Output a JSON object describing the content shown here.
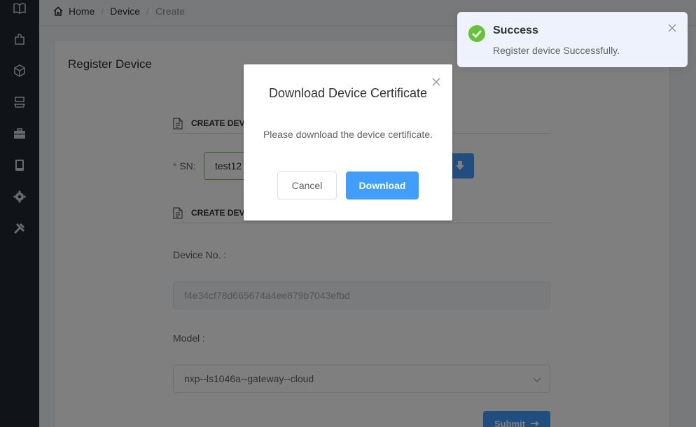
{
  "sidebar": {
    "items": [
      {
        "icon": "book-icon"
      },
      {
        "icon": "puzzle-icon"
      },
      {
        "icon": "cube-icon"
      },
      {
        "icon": "layout-icon"
      },
      {
        "icon": "briefcase-icon"
      },
      {
        "icon": "tablet-icon"
      },
      {
        "icon": "gear-icon"
      },
      {
        "icon": "tools-icon"
      }
    ]
  },
  "breadcrumb": {
    "home": "Home",
    "device": "Device",
    "current": "Create"
  },
  "page": {
    "title": "Register Device",
    "section1": "CREATE DEVIC",
    "section2": "CREATE DEVIC",
    "sn_label": "SN:",
    "sn_required": "*",
    "sn_value": "test12",
    "device_no_label": "Device No. :",
    "device_no_value": "f4e34cf78d665674a4ee879b7043efbd",
    "model_label": "Model :",
    "model_value": "nxp--ls1046a--gateway--cloud",
    "submit_label": "Submit"
  },
  "toast": {
    "title": "Success",
    "message": "Register device Successfully."
  },
  "dialog": {
    "title": "Download Device Certificate",
    "message": "Please download the device certificate.",
    "cancel": "Cancel",
    "download": "Download"
  },
  "colors": {
    "primary": "#409eff",
    "success": "#67c23a",
    "sidebar": "#202830"
  }
}
